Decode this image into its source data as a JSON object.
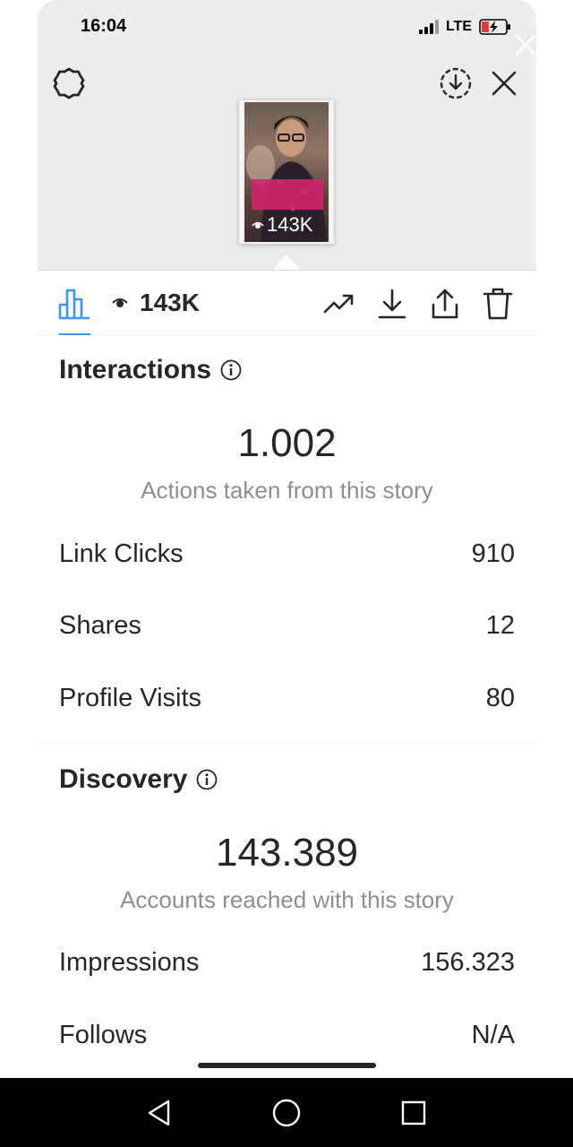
{
  "status_bar": {
    "time": "16:04",
    "network": "LTE",
    "icons": [
      "signal-icon",
      "battery-charging-icon"
    ]
  },
  "header": {
    "icons": [
      "gear-icon",
      "download-circle-icon",
      "close-icon"
    ]
  },
  "story_preview": {
    "views": "143K"
  },
  "tab_bar": {
    "views": "143K",
    "icons": [
      "bar-chart-icon",
      "eye-icon",
      "trend-icon",
      "download-icon",
      "share-icon",
      "trash-icon"
    ],
    "accent": "#3897f0"
  },
  "interactions": {
    "title": "Interactions",
    "total": "1.002",
    "caption": "Actions taken from this story",
    "rows": [
      {
        "label": "Link Clicks",
        "value": "910"
      },
      {
        "label": "Shares",
        "value": "12"
      },
      {
        "label": "Profile Visits",
        "value": "80"
      }
    ]
  },
  "discovery": {
    "title": "Discovery",
    "total": "143.389",
    "caption": "Accounts reached with this story",
    "rows": [
      {
        "label": "Impressions",
        "value": "156.323"
      },
      {
        "label": "Follows",
        "value": "N/A"
      }
    ]
  },
  "android_nav": {
    "icons": [
      "back-icon",
      "home-icon",
      "recents-icon"
    ]
  }
}
